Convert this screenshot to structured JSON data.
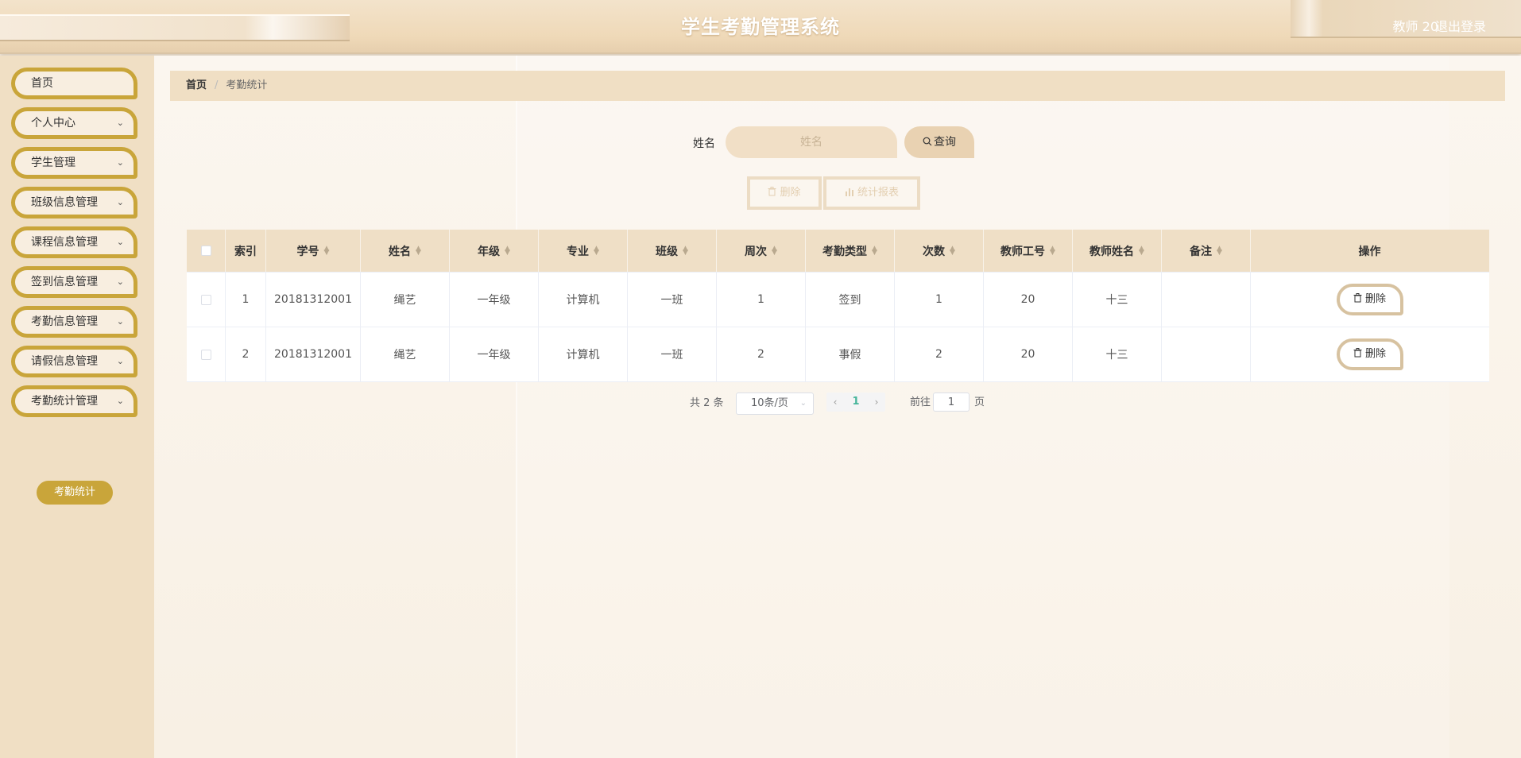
{
  "header": {
    "title": "学生考勤管理系统",
    "user": "教师 20",
    "logout": "退出登录"
  },
  "sidebar": {
    "items": [
      {
        "label": "首页"
      },
      {
        "label": "个人中心"
      },
      {
        "label": "学生管理"
      },
      {
        "label": "班级信息管理"
      },
      {
        "label": "课程信息管理"
      },
      {
        "label": "签到信息管理"
      },
      {
        "label": "考勤信息管理"
      },
      {
        "label": "请假信息管理"
      },
      {
        "label": "考勤统计管理"
      }
    ],
    "sub_item": "考勤统计",
    "chevron": "⌄"
  },
  "breadcrumb": {
    "home": "首页",
    "separator": "/",
    "current": "考勤统计"
  },
  "search": {
    "label": "姓名",
    "placeholder": "姓名",
    "button": "查询"
  },
  "actions": {
    "delete": "删除",
    "report": "统计报表"
  },
  "table": {
    "columns": [
      "索引",
      "学号",
      "姓名",
      "年级",
      "专业",
      "班级",
      "周次",
      "考勤类型",
      "次数",
      "教师工号",
      "教师姓名",
      "备注",
      "操作"
    ],
    "rows": [
      {
        "index": "1",
        "student_no": "20181312001",
        "name": "绳艺",
        "grade": "一年级",
        "major": "计算机",
        "class": "一班",
        "week": "1",
        "type": "签到",
        "count": "1",
        "teacher_no": "20",
        "teacher_name": "十三",
        "remark": "",
        "action": "删除"
      },
      {
        "index": "2",
        "student_no": "20181312001",
        "name": "绳艺",
        "grade": "一年级",
        "major": "计算机",
        "class": "一班",
        "week": "2",
        "type": "事假",
        "count": "2",
        "teacher_no": "20",
        "teacher_name": "十三",
        "remark": "",
        "action": "删除"
      }
    ]
  },
  "pagination": {
    "total": "共 2 条",
    "page_size": "10条/页",
    "current_page": "1",
    "goto_label": "前往",
    "goto_value": "1",
    "goto_suffix": "页"
  },
  "colors": {
    "accent": "#c9a53a",
    "header_bg": "#efd9b8",
    "table_head_bg": "#efdfc6",
    "page_active": "#46b59a"
  }
}
